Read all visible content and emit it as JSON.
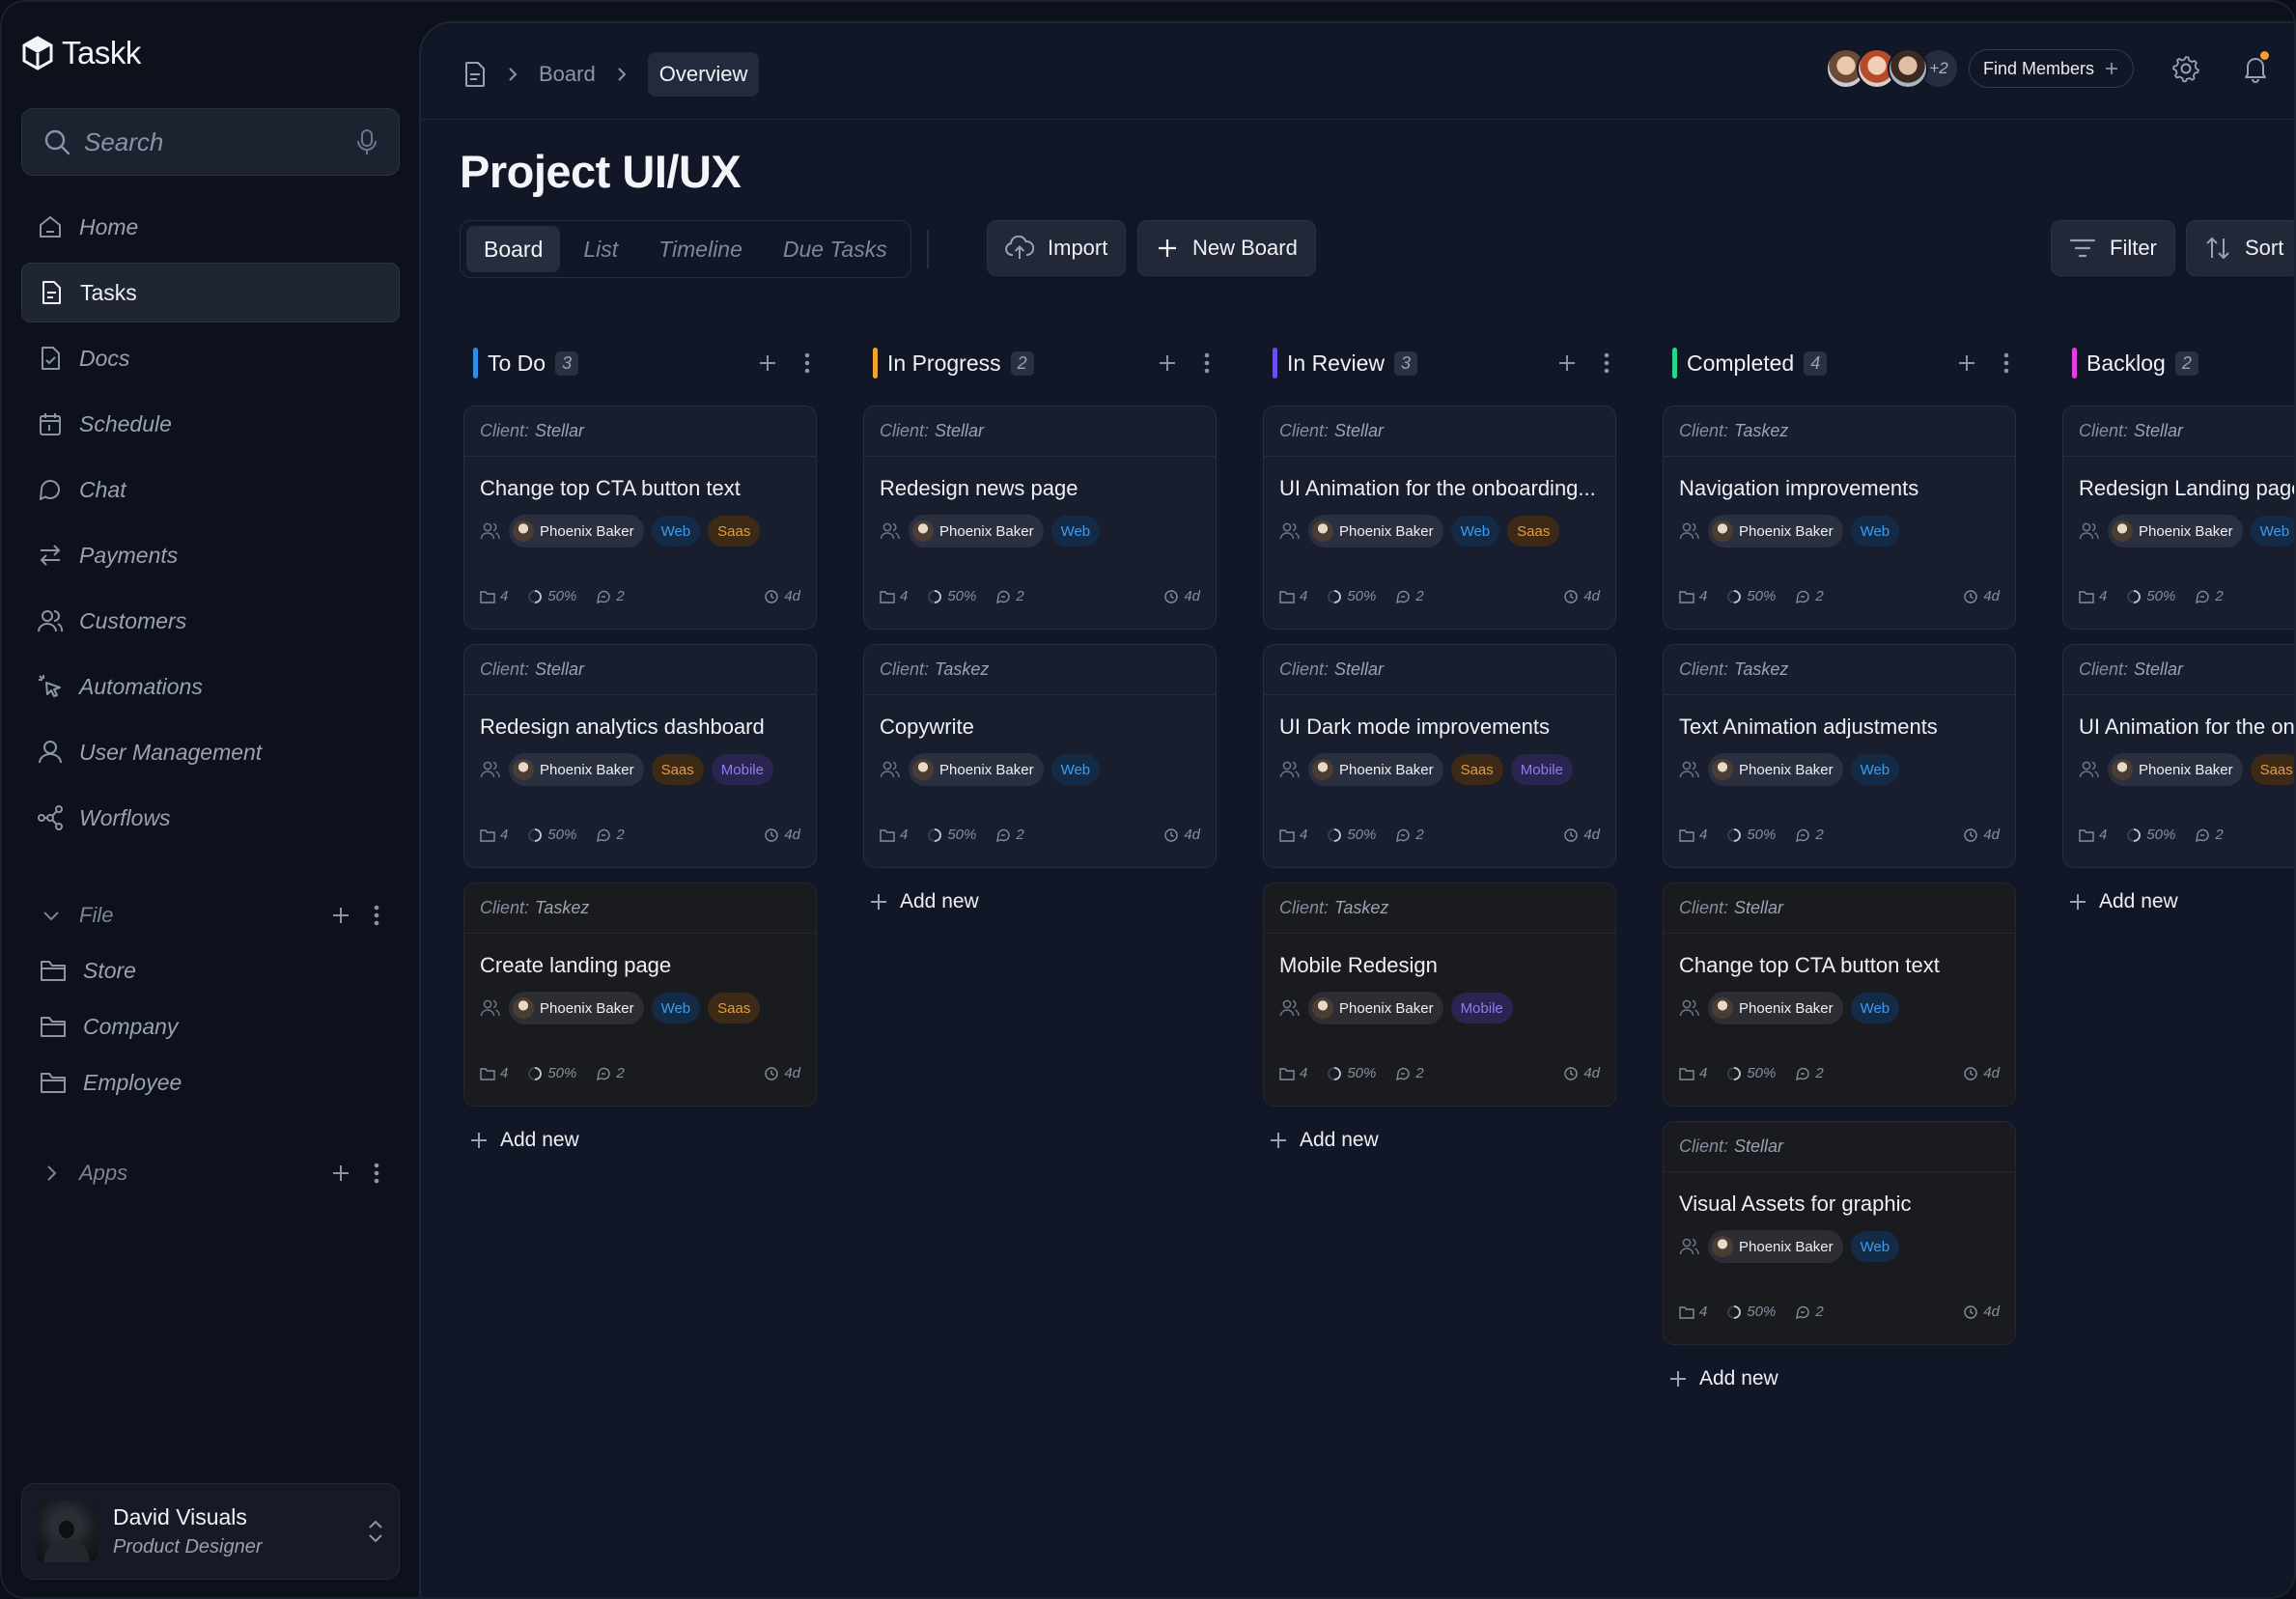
{
  "app": {
    "name": "Taskk"
  },
  "search": {
    "placeholder": "Search"
  },
  "sidebar": {
    "items": [
      {
        "label": "Home",
        "icon": "home-icon",
        "active": false
      },
      {
        "label": "Tasks",
        "icon": "file-icon",
        "active": true
      },
      {
        "label": "Docs",
        "icon": "doc-icon",
        "active": false
      },
      {
        "label": "Schedule",
        "icon": "calendar-icon",
        "active": false
      },
      {
        "label": "Chat",
        "icon": "chat-icon",
        "active": false
      },
      {
        "label": "Payments",
        "icon": "arrows-icon",
        "active": false
      },
      {
        "label": "Customers",
        "icon": "users-icon",
        "active": false
      },
      {
        "label": "Automations",
        "icon": "cursor-click-icon",
        "active": false
      },
      {
        "label": "User Management",
        "icon": "user-icon",
        "active": false
      },
      {
        "label": "Worflows",
        "icon": "workflow-icon",
        "active": false
      }
    ],
    "file_section": {
      "label": "File",
      "folders": [
        "Store",
        "Company",
        "Employee"
      ]
    },
    "apps_section": {
      "label": "Apps"
    }
  },
  "profile": {
    "name": "David Visuals",
    "role": "Product Designer"
  },
  "breadcrumb": {
    "parent": "Board",
    "current": "Overview"
  },
  "header": {
    "members_more": "+2",
    "find_members": "Find Members"
  },
  "page": {
    "title": "Project UI/UX"
  },
  "views": [
    "Board",
    "List",
    "Timeline",
    "Due Tasks"
  ],
  "toolbar": {
    "import": "Import",
    "new_board": "New Board",
    "filter": "Filter",
    "sort": "Sort"
  },
  "board": {
    "client_label": "Client:",
    "add_new": "Add new",
    "assignee": "Phoenix Baker",
    "meta": {
      "files": "4",
      "progress": "50%",
      "comments": "2",
      "due": "4d"
    },
    "columns": [
      {
        "title": "To Do",
        "count": "3",
        "color": "#2f8fe8",
        "cards": [
          {
            "client": "Stellar",
            "title": "Change top CTA button text",
            "tags": [
              "Web",
              "Saas"
            ],
            "dark": false
          },
          {
            "client": "Stellar",
            "title": "Redesign analytics dashboard",
            "tags": [
              "Saas",
              "Mobile"
            ],
            "dark": false
          },
          {
            "client": "Taskez",
            "title": "Create landing page",
            "tags": [
              "Web",
              "Saas"
            ],
            "dark": true
          }
        ]
      },
      {
        "title": "In Progress",
        "count": "2",
        "color": "#f0a32e",
        "cards": [
          {
            "client": "Stellar",
            "title": "Redesign news page",
            "tags": [
              "Web"
            ],
            "dark": false
          },
          {
            "client": "Taskez",
            "title": "Copywrite",
            "tags": [
              "Web"
            ],
            "dark": false
          }
        ]
      },
      {
        "title": "In Review",
        "count": "3",
        "color": "#6d4cf0",
        "cards": [
          {
            "client": "Stellar",
            "title": "UI Animation for the onboarding...",
            "tags": [
              "Web",
              "Saas"
            ],
            "dark": false
          },
          {
            "client": "Stellar",
            "title": "UI Dark mode improvements",
            "tags": [
              "Saas",
              "Mobile"
            ],
            "dark": false
          },
          {
            "client": "Taskez",
            "title": "Mobile Redesign",
            "tags": [
              "Mobile"
            ],
            "dark": true
          }
        ]
      },
      {
        "title": "Completed",
        "count": "4",
        "color": "#27d68a",
        "cards": [
          {
            "client": "Taskez",
            "title": "Navigation improvements",
            "tags": [
              "Web"
            ],
            "dark": false
          },
          {
            "client": "Taskez",
            "title": "Text Animation adjustments",
            "tags": [
              "Web"
            ],
            "dark": false
          },
          {
            "client": "Stellar",
            "title": "Change top CTA button text",
            "tags": [
              "Web"
            ],
            "dark": true
          },
          {
            "client": "Stellar",
            "title": "Visual Assets for graphic",
            "tags": [
              "Web"
            ],
            "dark": true
          }
        ]
      },
      {
        "title": "Backlog",
        "count": "2",
        "color": "#e43ce6",
        "cards": [
          {
            "client": "Stellar",
            "title": "Redesign Landing page",
            "tags": [
              "Web"
            ],
            "dark": false
          },
          {
            "client": "Stellar",
            "title": "UI Animation for the onboarding",
            "tags": [
              "Saas"
            ],
            "dark": false
          }
        ]
      }
    ]
  }
}
